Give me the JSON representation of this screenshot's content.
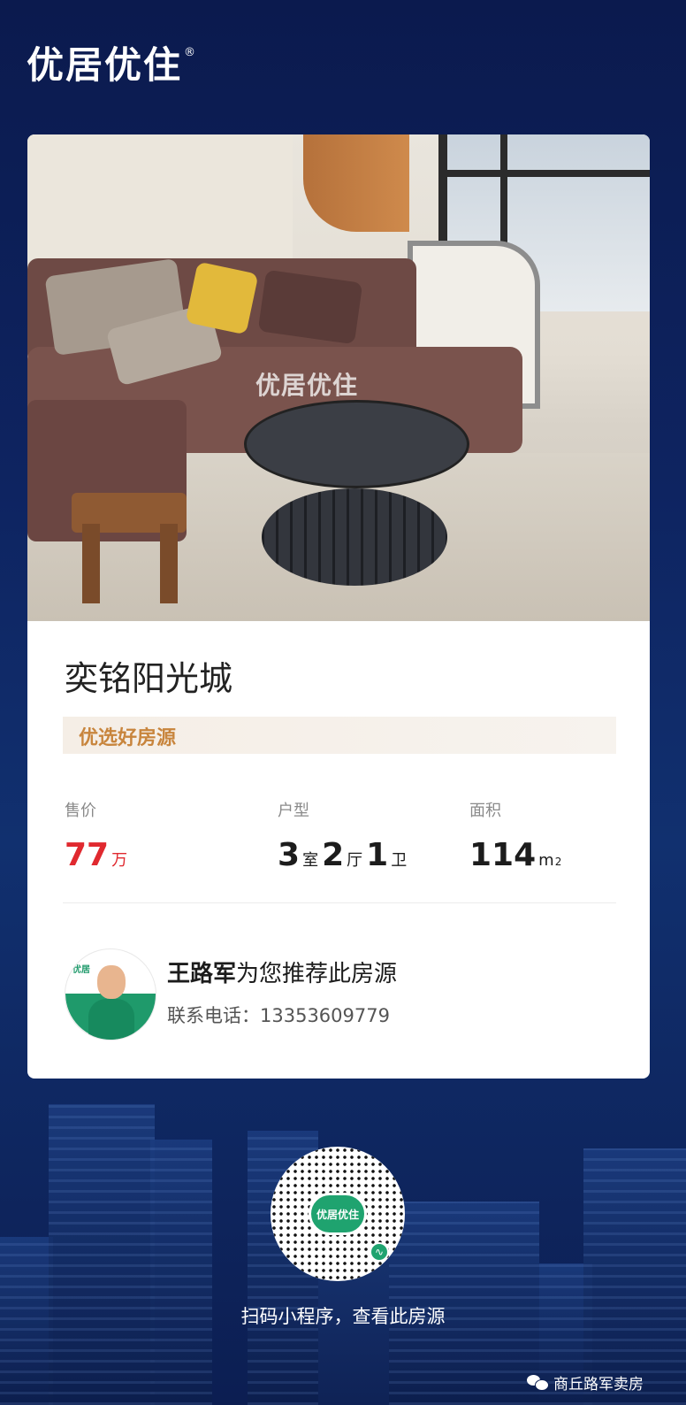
{
  "brand": {
    "logo_text": "优居优住",
    "registered_mark": "®"
  },
  "listing": {
    "title": "奕铭阳光城",
    "tag": "优选好房源",
    "photo_watermark": "优居优住",
    "price": {
      "label": "售价",
      "value": "77",
      "unit": "万"
    },
    "layout": {
      "label": "户型",
      "rooms": "3",
      "rooms_unit": "室",
      "halls": "2",
      "halls_unit": "厅",
      "baths": "1",
      "baths_unit": "卫"
    },
    "area": {
      "label": "面积",
      "value": "114",
      "unit": "m",
      "unit_sup": "2"
    }
  },
  "agent": {
    "name": "王路军",
    "recommend_text": "为您推荐此房源",
    "phone_label": "联系电话：",
    "phone": "13353609779",
    "avatar_logo": "优居"
  },
  "qr": {
    "center_text": "优居优住",
    "caption": "扫码小程序，查看此房源",
    "badge_icon": "mini-program-icon"
  },
  "footer": {
    "account_name": "商丘路军卖房",
    "icon": "wechat-icon"
  },
  "colors": {
    "background": "#0e2461",
    "price_red": "#e0292f",
    "tag_text": "#c8853d",
    "brand_green": "#1fa36f"
  }
}
